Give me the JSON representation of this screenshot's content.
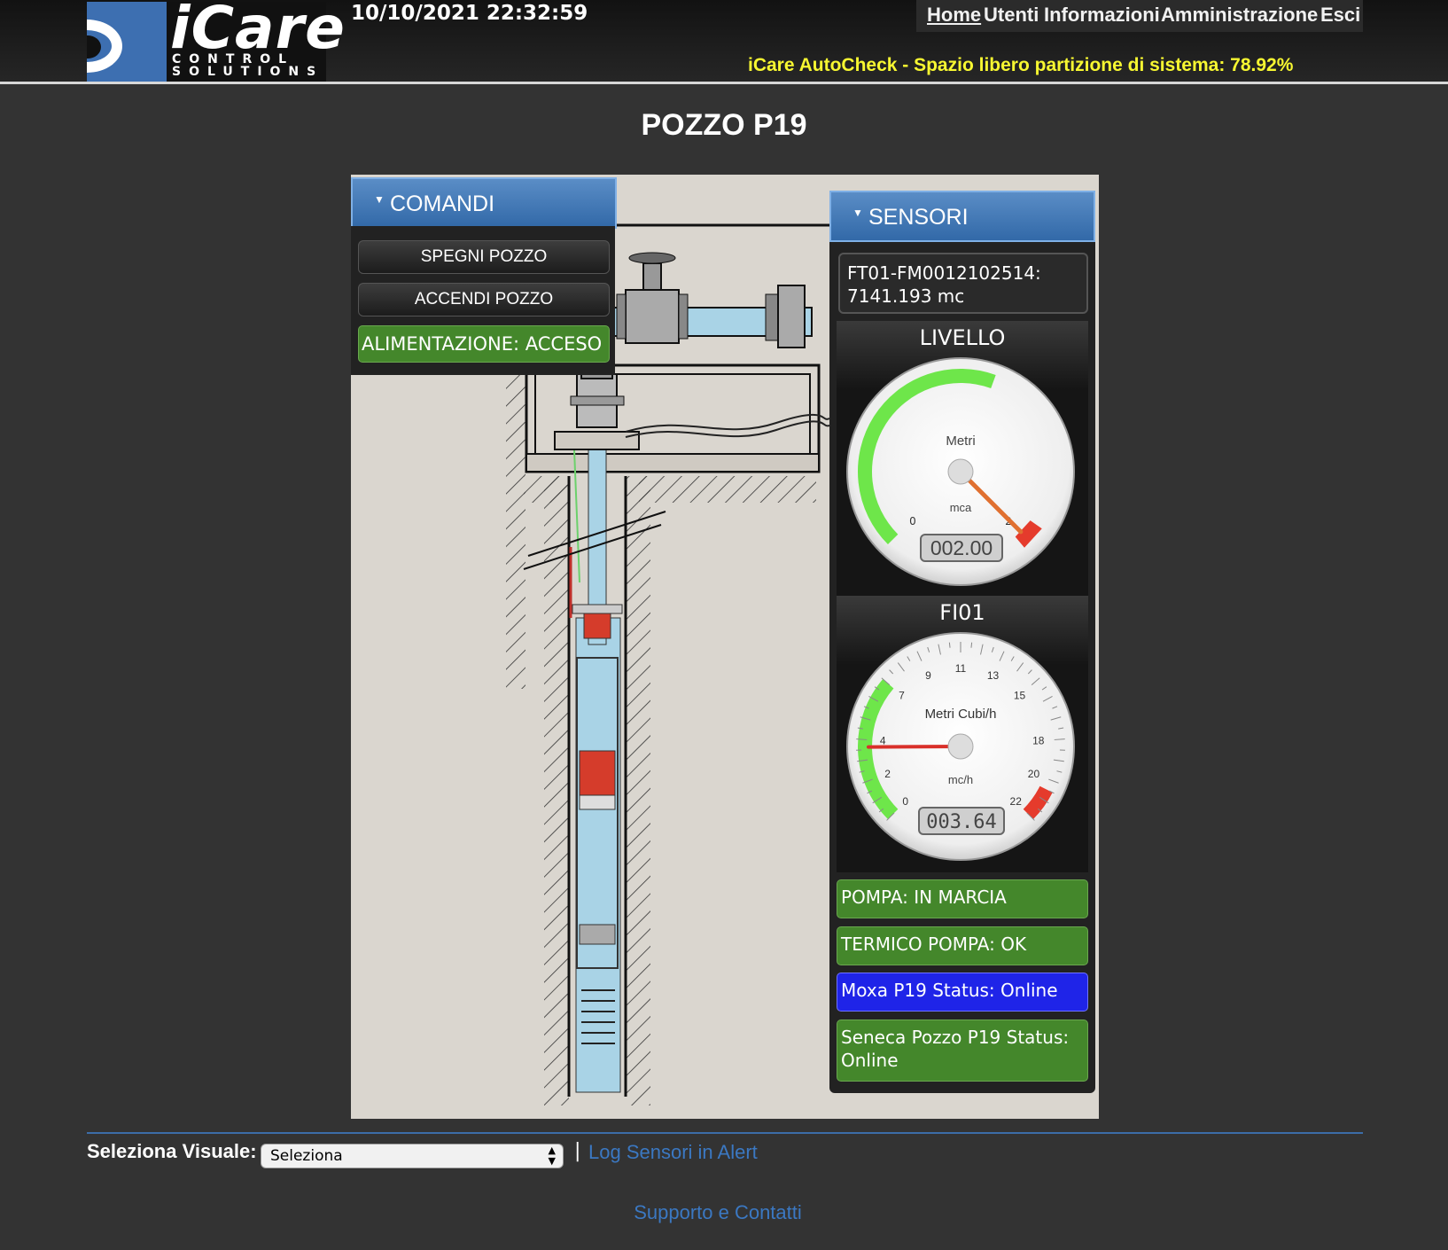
{
  "header": {
    "logo_text": "iCare",
    "logo_sub": "CONTROL SOLUTIONS",
    "datetime": "10/10/2021 22:32:59",
    "nav": [
      "Home",
      "Utenti",
      "Informazioni",
      "Amministrazione",
      "Esci"
    ],
    "autocheck": "iCare AutoCheck - Spazio libero partizione di sistema: 78.92%"
  },
  "page_title": "POZZO P19",
  "comandi": {
    "title": "COMANDI",
    "buttons": [
      "SPEGNI POZZO",
      "ACCENDI POZZO"
    ],
    "alimentazione": "ALIMENTAZIONE: ACCESO"
  },
  "sensori": {
    "title": "SENSORI",
    "meter_name": "FT01-FM0012102514:",
    "meter_value": "7141.193 mc",
    "livello": {
      "title": "LIVELLO",
      "unit_label": "Metri",
      "unit_short": "mca",
      "min_label": "0",
      "max_label": "2",
      "readout": "002.00",
      "value": 2.0,
      "max": 2.0
    },
    "fi01": {
      "title": "FI01",
      "unit_label": "Metri Cubi/h",
      "unit_short": "mc/h",
      "ticks": [
        "0",
        "2",
        "4",
        "7",
        "9",
        "11",
        "13",
        "15",
        "18",
        "20",
        "22"
      ],
      "readout": "003.64",
      "value": 3.64,
      "max": 22
    },
    "statuses": [
      {
        "text": "POMPA: IN MARCIA",
        "color": "green"
      },
      {
        "text": "TERMICO POMPA: OK",
        "color": "green"
      },
      {
        "text": "Moxa P19 Status: Online",
        "color": "blue"
      },
      {
        "text": "Seneca Pozzo P19 Status: Online",
        "color": "green"
      }
    ]
  },
  "footer": {
    "select_label": "Seleziona Visuale:",
    "select_value": "Seleziona",
    "separator": "|",
    "log_link": "Log Sensori in Alert",
    "support_link": "Supporto e Contatti"
  },
  "colors": {
    "accent_blue": "#3b78c2",
    "status_green": "#44872b",
    "status_blue": "#1f24e8",
    "autocheck_yellow": "#f7f731"
  }
}
